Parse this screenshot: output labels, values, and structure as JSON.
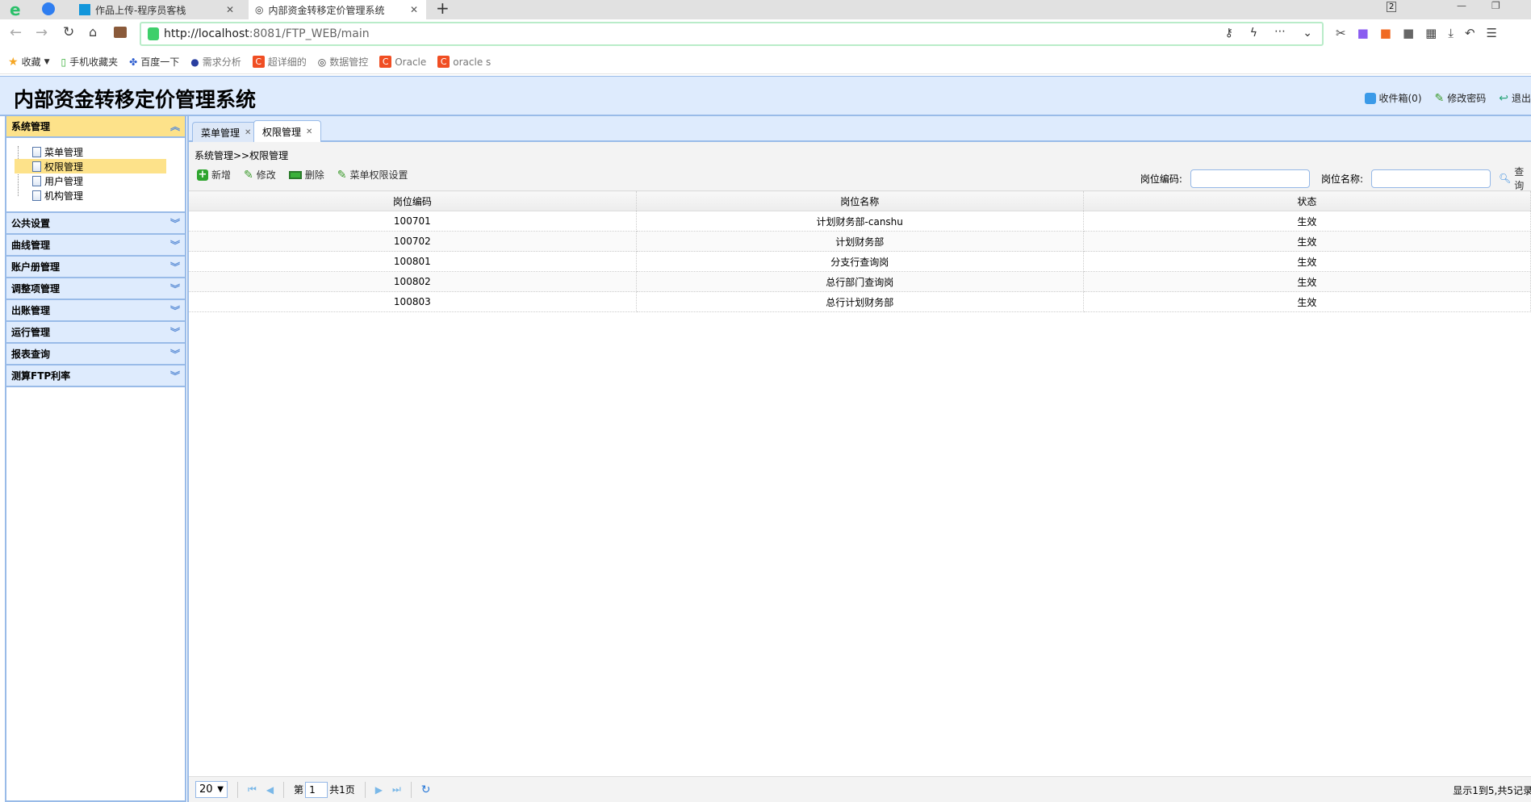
{
  "browser": {
    "tabs": [
      {
        "label": "作品上传-程序员客栈",
        "icon": "terminal-icon"
      },
      {
        "label": "内部资金转移定价管理系统",
        "icon": "globe-icon"
      }
    ],
    "url_host": "http://localhost",
    "url_rest": ":8081/FTP_WEB/main",
    "tab_count": "2",
    "bookmarks": [
      "收藏",
      "手机收藏夹",
      "百度一下",
      "需求分析",
      "超详细的",
      "数据管控",
      "Oracle",
      "oracle s"
    ]
  },
  "header": {
    "title": "内部资金转移定价管理系统",
    "inbox": "收件箱(0)",
    "change_password": "修改密码",
    "logout": "退出"
  },
  "sidebar": {
    "open_group": "系统管理",
    "tree": [
      {
        "label": "菜单管理",
        "selected": false
      },
      {
        "label": "权限管理",
        "selected": true
      },
      {
        "label": "用户管理",
        "selected": false
      },
      {
        "label": "机构管理",
        "selected": false
      }
    ],
    "groups": [
      "公共设置",
      "曲线管理",
      "账户册管理",
      "调整项管理",
      "出账管理",
      "运行管理",
      "报表查询",
      "测算FTP利率"
    ]
  },
  "main": {
    "tabs": [
      {
        "label": "菜单管理"
      },
      {
        "label": "权限管理",
        "active": true
      }
    ],
    "breadcrumb": "系统管理>>权限管理",
    "toolbar": {
      "add": "新增",
      "edit": "修改",
      "delete": "删除",
      "menu_perm": "菜单权限设置"
    },
    "search": {
      "code_label": "岗位编码:",
      "name_label": "岗位名称:",
      "code_value": "",
      "name_value": "",
      "button": "查询"
    },
    "columns": [
      "岗位编码",
      "岗位名称",
      "状态"
    ],
    "rows": [
      [
        "100701",
        "计划财务部-canshu",
        "生效"
      ],
      [
        "100702",
        "计划财务部",
        "生效"
      ],
      [
        "100801",
        "分支行查询岗",
        "生效"
      ],
      [
        "100802",
        "总行部门查询岗",
        "生效"
      ],
      [
        "100803",
        "总行计划财务部",
        "生效"
      ]
    ],
    "pager": {
      "page_size": "20",
      "page_prefix": "第",
      "page": "1",
      "page_total": "共1页",
      "info": "显示1到5,共5记录"
    }
  }
}
